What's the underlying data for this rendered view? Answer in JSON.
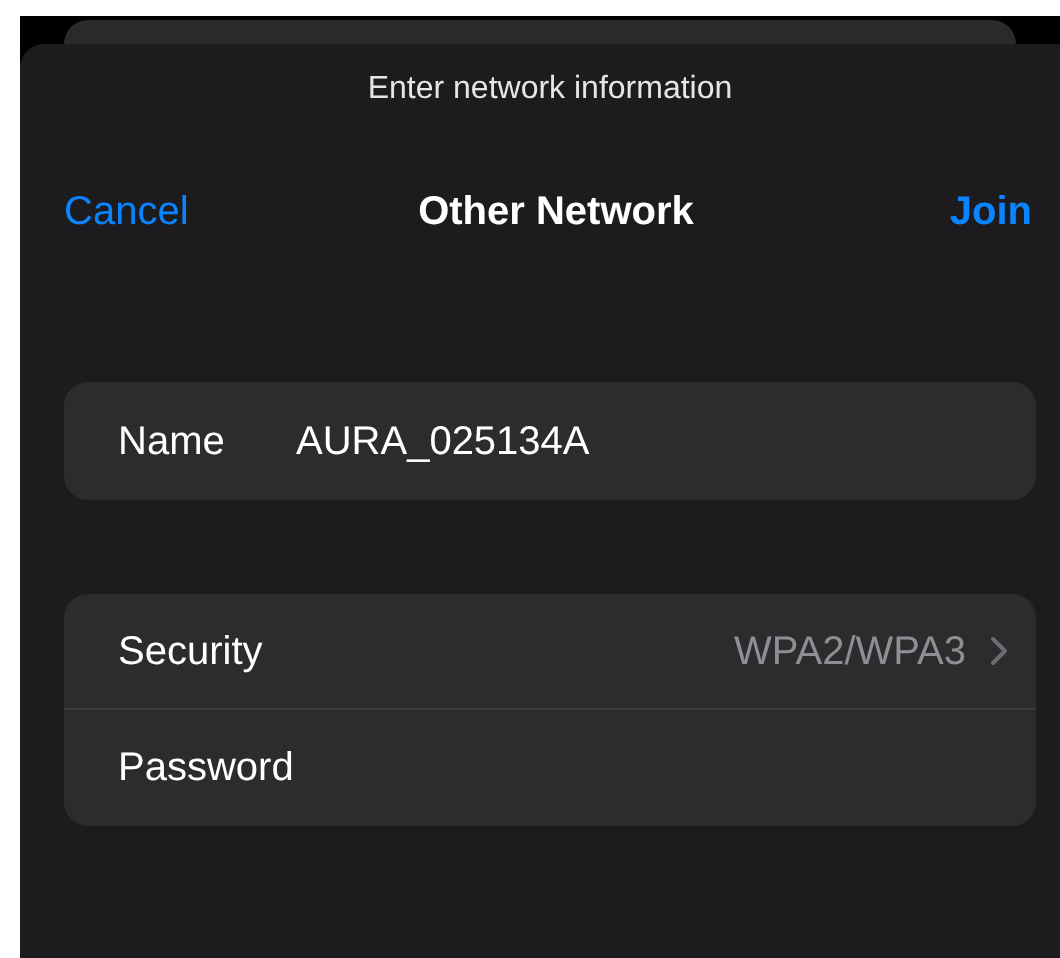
{
  "prompt": "Enter network information",
  "nav": {
    "cancel": "Cancel",
    "title": "Other Network",
    "join": "Join"
  },
  "name_field": {
    "label": "Name",
    "value": "AURA_025134A"
  },
  "rows": [
    {
      "kind": "disclosure",
      "label": "Security",
      "value": "WPA2/WPA3"
    },
    {
      "kind": "input",
      "label": "Password"
    }
  ]
}
